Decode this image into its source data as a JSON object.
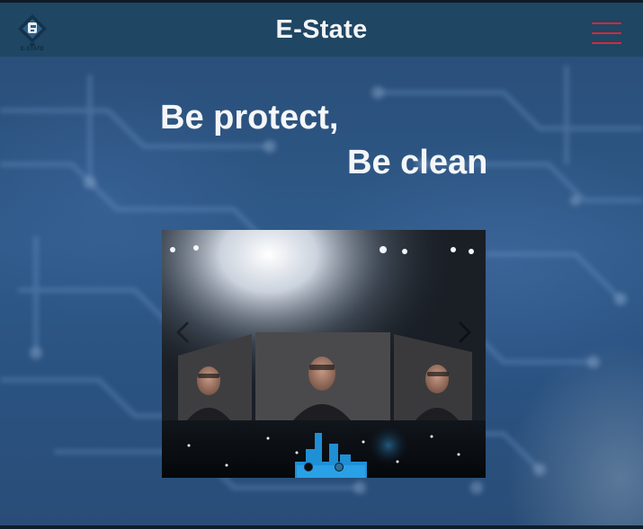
{
  "header": {
    "logo_letter": "E",
    "logo_text": "E-STATE",
    "title": "E-State",
    "menu_icon": "hamburger-menu-icon"
  },
  "hero": {
    "line1": "Be protect,",
    "line2": "Be clean"
  },
  "carousel": {
    "prev_icon": "chevron-left-icon",
    "next_icon": "chevron-right-icon",
    "slide_count": 2,
    "active_index": 0
  },
  "colors": {
    "header_bg": "#1f4663",
    "menu_accent": "#d6273b",
    "page_bg": "#2f5a89",
    "text": "#f4f6f8"
  }
}
